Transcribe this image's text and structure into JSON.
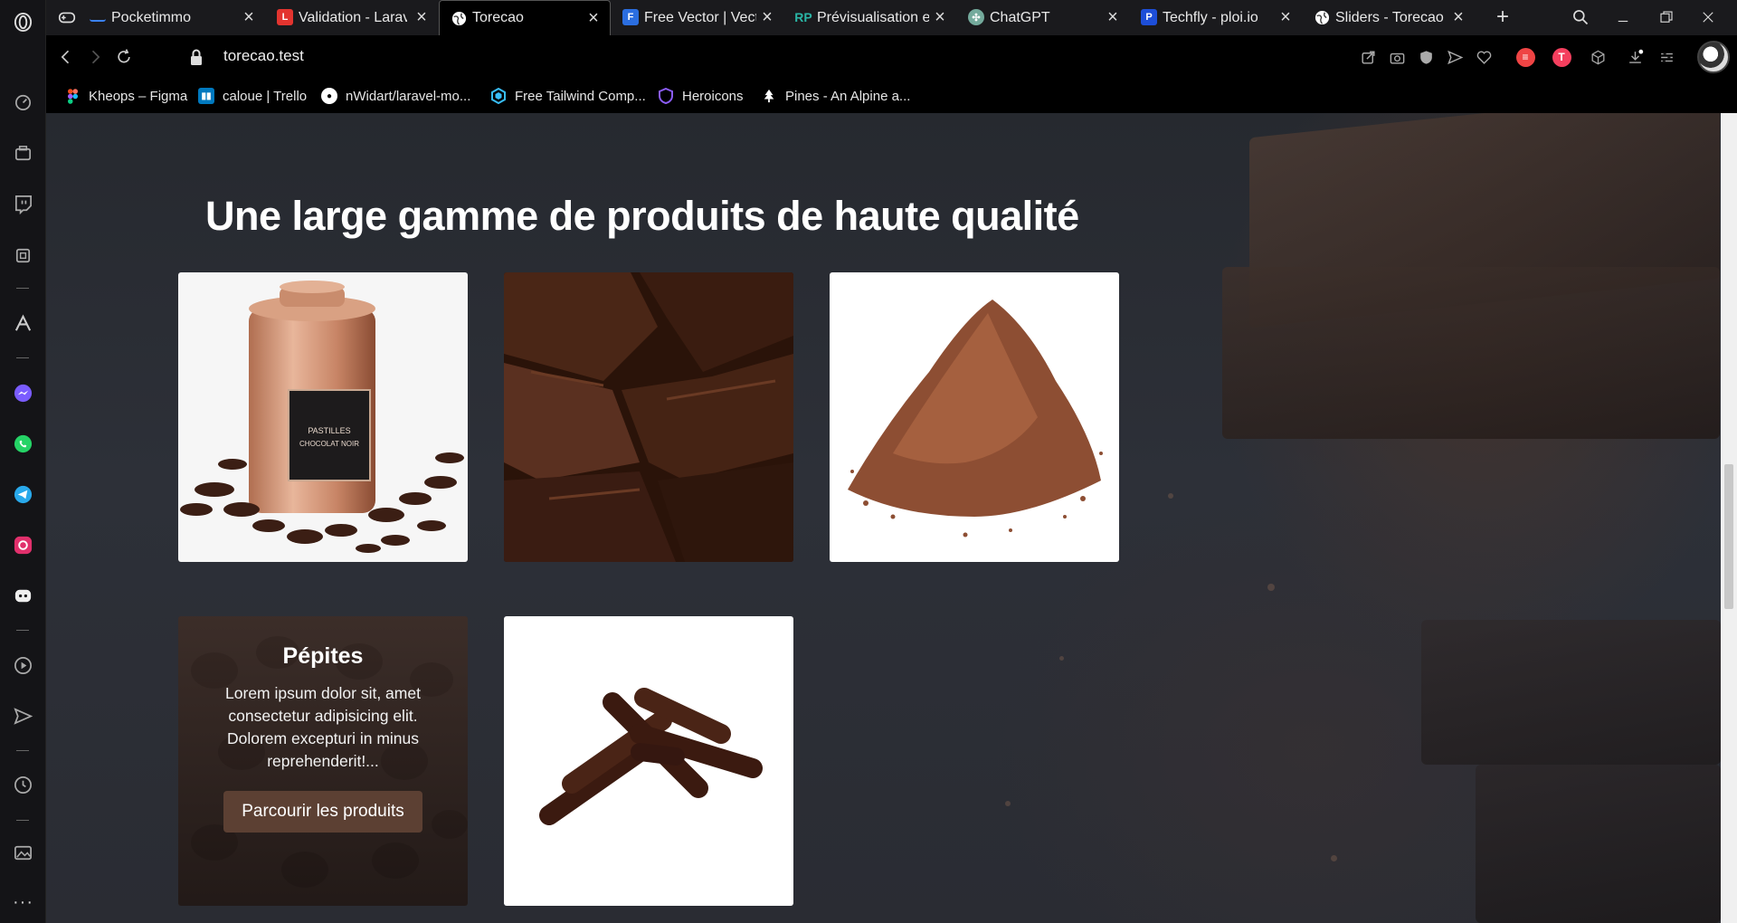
{
  "tabs": [
    {
      "title": "Pocketimmo",
      "favicon": "line-icon",
      "color": "#1a1a1d",
      "active": false
    },
    {
      "title": "Validation - Laravel",
      "favicon": "laravel-icon",
      "color": "#e3342f",
      "active": false
    },
    {
      "title": "Torecao",
      "favicon": "globe-icon",
      "color": "#ffffff",
      "active": true
    },
    {
      "title": "Free Vector | Vecte",
      "favicon": "freepik-icon",
      "color": "#2b6ee0",
      "active": false
    },
    {
      "title": "Prévisualisation et",
      "favicon": "rp-icon",
      "color": "#2ab5a5",
      "active": false
    },
    {
      "title": "ChatGPT",
      "favicon": "chatgpt-icon",
      "color": "#74aa9c",
      "active": false
    },
    {
      "title": "Techfly - ploi.io",
      "favicon": "ploi-icon",
      "color": "#1d4ed8",
      "active": false
    },
    {
      "title": "Sliders - Torecao",
      "favicon": "globe-icon",
      "color": "#ffffff",
      "active": false
    }
  ],
  "address": {
    "url": "torecao.test"
  },
  "bookmarks": [
    {
      "label": "Kheops – Figma",
      "icon": "figma-icon",
      "color": "#f24e1e"
    },
    {
      "label": "caloue | Trello",
      "icon": "trello-icon",
      "color": "#0079bf"
    },
    {
      "label": "nWidart/laravel-mo...",
      "icon": "github-icon",
      "color": "#ffffff"
    },
    {
      "label": "Free Tailwind Comp...",
      "icon": "tailwind-icon",
      "color": "#38bdf8"
    },
    {
      "label": "Heroicons",
      "icon": "heroicons-icon",
      "color": "#8b5cf6"
    },
    {
      "label": "Pines - An Alpine a...",
      "icon": "pine-tree-icon",
      "color": "#ffffff"
    }
  ],
  "page": {
    "heading": "Une large gamme de produits de haute qualité",
    "products": [
      {
        "name": "pastilles",
        "image": "pastilles-jar-image",
        "overlay": false
      },
      {
        "name": "blocs",
        "image": "chocolate-blocks-image",
        "overlay": false
      },
      {
        "name": "poudre",
        "image": "cocoa-powder-image",
        "overlay": false
      },
      {
        "name": "pepites",
        "image": "chocolate-chips-image",
        "overlay": true,
        "title": "Pépites",
        "description": "Lorem ipsum dolor sit, amet consectetur adipisicing elit. Dolorem excepturi in minus reprehenderit!...",
        "button": "Parcourir les produits"
      },
      {
        "name": "batons",
        "image": "chocolate-sticks-image",
        "overlay": false
      }
    ],
    "jar_label": {
      "line1": "PASTILLES",
      "line2": "CHOCOLAT NOIR"
    }
  },
  "colors": {
    "accent_button": "#5c4033",
    "page_bg": "#2b2e35"
  }
}
